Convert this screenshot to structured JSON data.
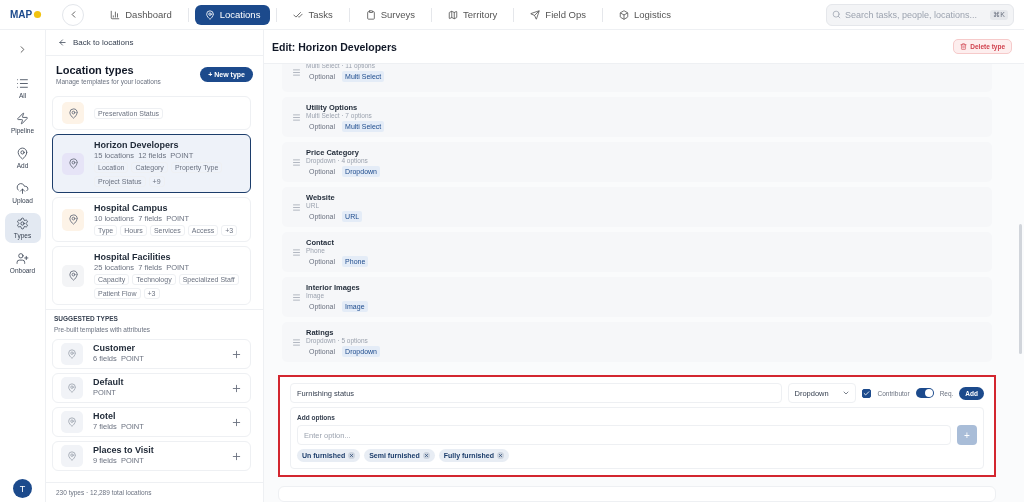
{
  "top_nav": {
    "logo": "MAP",
    "tabs": [
      {
        "label": "Dashboard",
        "selected": false
      },
      {
        "label": "Locations",
        "selected": true
      },
      {
        "label": "Tasks",
        "selected": false
      },
      {
        "label": "Surveys",
        "selected": false
      },
      {
        "label": "Territory",
        "selected": false
      },
      {
        "label": "Field Ops",
        "selected": false
      },
      {
        "label": "Logistics",
        "selected": false
      }
    ],
    "search": {
      "placeholder": "Search tasks, people, locations...",
      "shortcut": "⌘K"
    }
  },
  "rail": {
    "items": [
      {
        "label": "All",
        "selected": false
      },
      {
        "label": "Pipeline",
        "selected": false
      },
      {
        "label": "Add",
        "selected": false
      },
      {
        "label": "Upload",
        "selected": false
      },
      {
        "label": "Types",
        "selected": true
      },
      {
        "label": "Onboard",
        "selected": false
      }
    ],
    "avatar": "T"
  },
  "types_panel": {
    "back": "Back to locations",
    "title": "Location types",
    "subtitle": "Manage templates for your locations",
    "new_button": "+ New type",
    "types": [
      {
        "tags": [
          "Preservation Status"
        ],
        "selected": false,
        "color": "#fdf3e7"
      },
      {
        "name": "Horizon Developers",
        "meta": "15 locations  12 fields  POINT",
        "tags": [
          "Location",
          "Category",
          "Property Type",
          "Project Status",
          "+9"
        ],
        "selected": true,
        "color": "#e6e4f7"
      },
      {
        "name": "Hospital Campus",
        "meta": "10 locations  7 fields  POINT",
        "tags": [
          "Type",
          "Hours",
          "Services",
          "Access",
          "+3"
        ],
        "selected": false,
        "color": "#fdf3e7"
      },
      {
        "name": "Hospital Facilities",
        "meta": "25 locations  7 fields  POINT",
        "tags": [
          "Capacity",
          "Technology",
          "Specialized Staff",
          "Patient Flow",
          "+3"
        ],
        "selected": false,
        "color": "#f3f4f6"
      }
    ],
    "suggested_title": "SUGGESTED TYPES",
    "suggested_subtitle": "Pre-built templates with attributes",
    "suggested": [
      {
        "name": "Customer",
        "meta": "6 fields  POINT"
      },
      {
        "name": "Default",
        "meta": "POINT"
      },
      {
        "name": "Hotel",
        "meta": "7 fields  POINT"
      },
      {
        "name": "Places to Visit",
        "meta": "9 fields  POINT"
      }
    ],
    "footer": "230 types · 12,289 total locations"
  },
  "editor": {
    "title": "Edit: Horizon Developers",
    "delete_button": "Delete type",
    "fields": [
      {
        "meta": "Multi Select · 11 options",
        "requirement": "Optional",
        "type": "Multi Select"
      },
      {
        "name": "Utility Options",
        "meta": "Multi Select · 7 options",
        "requirement": "Optional",
        "type": "Multi Select"
      },
      {
        "name": "Price Category",
        "meta": "Dropdown · 4 options",
        "requirement": "Optional",
        "type": "Dropdown"
      },
      {
        "name": "Website",
        "meta": "URL",
        "requirement": "Optional",
        "type": "URL"
      },
      {
        "name": "Contact",
        "meta": "Phone",
        "requirement": "Optional",
        "type": "Phone"
      },
      {
        "name": "Interior Images",
        "meta": "Image",
        "requirement": "Optional",
        "type": "Image"
      },
      {
        "name": "Ratings",
        "meta": "Dropdown · 5 options",
        "requirement": "Optional",
        "type": "Dropdown"
      }
    ],
    "new_field": {
      "name": "Furnishing status",
      "type": "Dropdown",
      "contributor_label": "Contributor",
      "contributor": true,
      "required_label": "Req.",
      "required": true,
      "add_button": "Add",
      "options_label": "Add options",
      "option_placeholder": "Enter option...",
      "add_option_button": "+",
      "options": [
        "Un furnished",
        "Semi furnished",
        "Fully furnished"
      ]
    }
  }
}
